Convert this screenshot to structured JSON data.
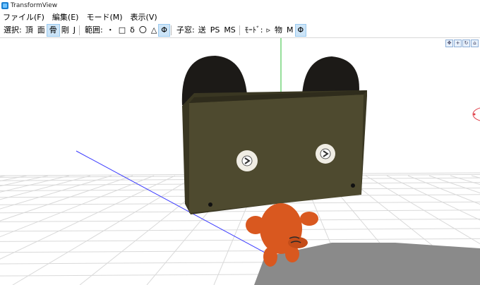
{
  "window": {
    "title": "TransformView"
  },
  "menu": [
    {
      "label": "ファイル(F)"
    },
    {
      "label": "編集(E)"
    },
    {
      "label": "モード(M)"
    },
    {
      "label": "表示(V)"
    }
  ],
  "toolbar": {
    "select_label": "選択:",
    "select_items": [
      {
        "label": "頂",
        "active": false
      },
      {
        "label": "面",
        "active": false
      },
      {
        "label": "骨",
        "active": true
      },
      {
        "label": "剛",
        "active": false
      },
      {
        "label": "J",
        "active": false
      }
    ],
    "range_label": "範囲:",
    "range_items": [
      {
        "label": "・",
        "active": false
      },
      {
        "label": "□",
        "active": false
      },
      {
        "label": "δ",
        "active": false
      },
      {
        "label": "〇",
        "active": false
      },
      {
        "label": "△",
        "active": false
      },
      {
        "label": "Φ",
        "active": true
      }
    ],
    "child_label": "子窓:",
    "child_items": [
      {
        "label": "送",
        "active": false
      },
      {
        "label": "PS",
        "active": false
      },
      {
        "label": "MS",
        "active": false
      }
    ],
    "mode_label": "ﾓｰﾄﾞ:",
    "mode_items": [
      {
        "label": "▹",
        "active": false
      },
      {
        "label": "物",
        "active": false
      },
      {
        "label": "M",
        "active": false
      },
      {
        "label": "Φ",
        "active": true
      }
    ]
  },
  "colors": {
    "accent": "#cce4f7",
    "grid": "#d9d9d9",
    "box": "#4e4a2f",
    "ears": "#1c1a17",
    "character": "#d9581f",
    "shadow": "#8a8a8a"
  }
}
